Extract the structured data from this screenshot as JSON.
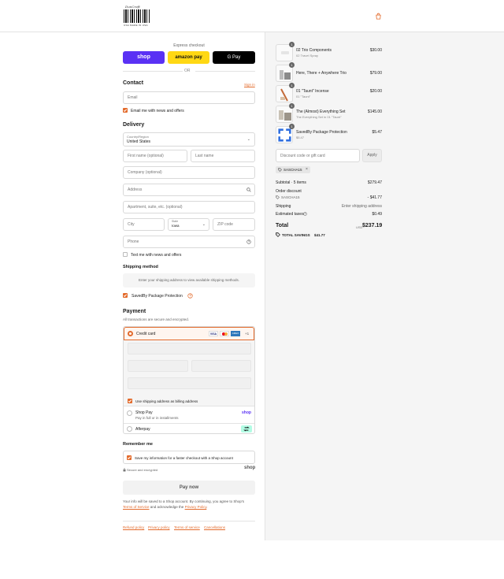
{
  "header": {
    "logo_caption": "DunCraft",
    "logo_subtext": "USA MADE IN USA"
  },
  "express": {
    "title": "Express checkout",
    "shop_label": "shop",
    "amazon_label": "amazon pay",
    "gpay_label": "G Pay",
    "or_label": "OR"
  },
  "contact": {
    "heading": "Contact",
    "signin": "Sign in",
    "email_placeholder": "Email",
    "news_label": "Email me with news and offers"
  },
  "delivery": {
    "heading": "Delivery",
    "country_label": "Country/Region",
    "country_value": "United States",
    "first_name": "First name (optional)",
    "last_name": "Last name",
    "company": "Company (optional)",
    "address": "Address",
    "apartment": "Apartment, suite, etc. (optional)",
    "city": "City",
    "state_label": "State",
    "state_value": "Iowa",
    "zip": "ZIP code",
    "phone": "Phone",
    "text_label": "Text me with news and offers"
  },
  "shipping": {
    "heading": "Shipping method",
    "message": "Enter your shipping address to view available shipping methods."
  },
  "protection": {
    "label": "SavedBy Package Protection"
  },
  "payment": {
    "heading": "Payment",
    "subtitle": "All transactions are secure and encrypted.",
    "credit_card": "Credit card",
    "card_more": "+1",
    "visa": "VISA",
    "amex": "AMEX",
    "billing_label": "Use shipping address as billing address",
    "shop_pay": "Shop Pay",
    "shop_pay_sub": "Pay in full or in installments",
    "shop_pay_logo": "shop",
    "afterpay": "Afterpay"
  },
  "remember": {
    "heading": "Remember me",
    "label": "Save my information for a faster checkout with a Shop account",
    "secure": "Secure and encrypted",
    "shop_logo": "shop"
  },
  "pay_button": "Pay now",
  "disclaimer": {
    "line1": "Your info will be saved to a Shop account. By continuing, you agree to Shop's",
    "terms": "Terms of Service",
    "and": "and acknowledge the",
    "privacy": "Privacy Policy",
    "end": "."
  },
  "footer_links": [
    "Refund policy",
    "Privacy policy",
    "Terms of service",
    "Cancellations"
  ],
  "cart": {
    "items": [
      {
        "qty": "1",
        "name": "02 Trio Components",
        "sub": "02 Travel Spray",
        "price": "$30.00"
      },
      {
        "qty": "1",
        "name": "Here, There + Anywhere Trio",
        "sub": "",
        "price": "$79.00"
      },
      {
        "qty": "1",
        "name": "01 \"Taunt\" Incense",
        "sub": "01 \"Taunt\"",
        "price": "$20.00"
      },
      {
        "qty": "1",
        "name": "The (Almost) Everything Set",
        "sub": "The Everything Set in 01 \"Taunt\"",
        "price": "$145.00"
      },
      {
        "qty": "1",
        "name": "SavedBy Package Protection",
        "sub": "$5.47",
        "price": "$5.47"
      }
    ],
    "discount_placeholder": "Discount code or gift card",
    "apply": "Apply",
    "code": "SASCHA15",
    "subtotal_label": "Subtotal · 5 items",
    "subtotal": "$279.47",
    "order_discount": "Order discount",
    "code_label": "SASCHA15",
    "discount": "- $41.77",
    "shipping_label": "Shipping",
    "shipping_value": "Enter shipping address",
    "taxes_label": "Estimated taxes",
    "taxes": "$0.49",
    "total_label": "Total",
    "currency": "USD",
    "total": "$237.19",
    "savings_label": "TOTAL SAVINGS",
    "savings": "$41.77"
  },
  "colors": {
    "accent": "#e36b2c",
    "shop": "#5a31f4",
    "amazon": "#ffd814",
    "afterpay": "#b2fce4"
  }
}
